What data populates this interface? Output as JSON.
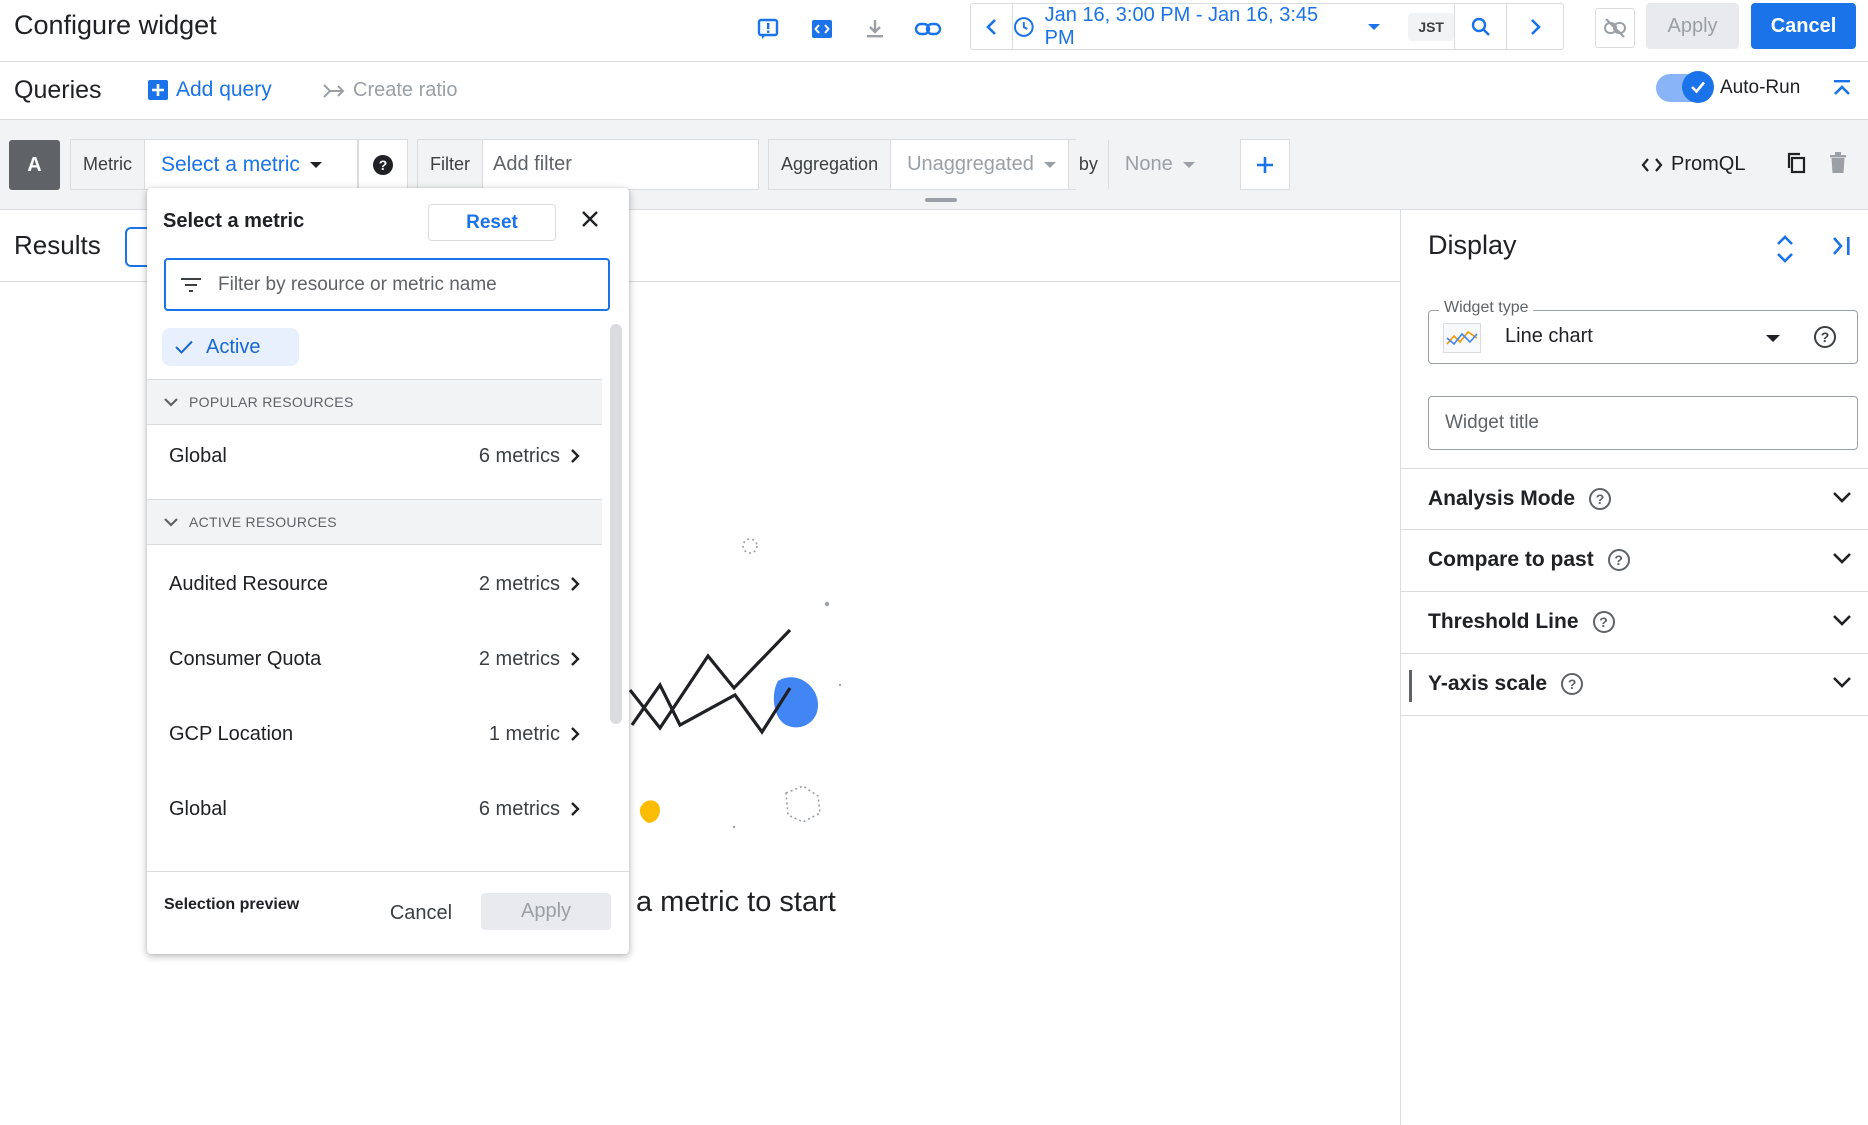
{
  "header": {
    "title": "Configure widget",
    "time_range": "Jan 16, 3:00 PM - Jan 16, 3:45 PM",
    "timezone": "JST",
    "apply_label": "Apply",
    "cancel_label": "Cancel"
  },
  "queries": {
    "label": "Queries",
    "add_query_label": "Add query",
    "create_ratio_label": "Create ratio",
    "autorun_label": "Auto-Run",
    "autorun_on": true
  },
  "query_row": {
    "letter": "A",
    "metric_label": "Metric",
    "metric_value": "Select a metric",
    "filter_label": "Filter",
    "filter_placeholder": "Add filter",
    "aggregation_label": "Aggregation",
    "aggregation_value": "Unaggregated",
    "by_label": "by",
    "by_value": "None",
    "promql_label": "PromQL"
  },
  "results": {
    "label": "Results",
    "empty_text": "a metric to start"
  },
  "display": {
    "title": "Display",
    "widget_type_label": "Widget type",
    "widget_type_value": "Line chart",
    "widget_title_placeholder": "Widget title",
    "sections": [
      {
        "label": "Analysis Mode"
      },
      {
        "label": "Compare to past"
      },
      {
        "label": "Threshold Line"
      },
      {
        "label": "Y-axis scale"
      }
    ]
  },
  "metric_dropdown": {
    "title": "Select a metric",
    "reset_label": "Reset",
    "filter_placeholder": "Filter by resource or metric name",
    "active_chip": "Active",
    "popular_header": "POPULAR RESOURCES",
    "popular_items": [
      {
        "name": "Global",
        "count": "6 metrics"
      }
    ],
    "active_header": "ACTIVE RESOURCES",
    "active_items": [
      {
        "name": "Audited Resource",
        "count": "2 metrics"
      },
      {
        "name": "Consumer Quota",
        "count": "2 metrics"
      },
      {
        "name": "GCP Location",
        "count": "1 metric"
      },
      {
        "name": "Global",
        "count": "6 metrics"
      }
    ],
    "selection_preview_label": "Selection preview",
    "cancel_label": "Cancel",
    "apply_label": "Apply"
  },
  "colors": {
    "accent": "#1a73e8",
    "illustration_blue": "#4285f4",
    "illustration_yellow": "#fbbc04"
  }
}
